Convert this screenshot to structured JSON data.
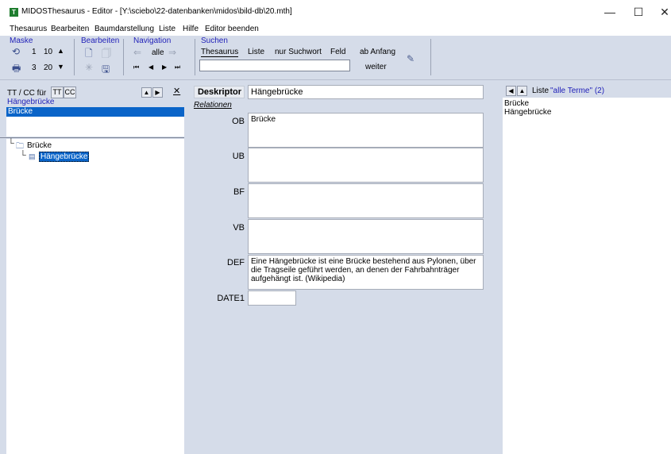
{
  "window": {
    "title": "MIDOSThesaurus - Editor - [Y:\\sciebo\\22-datenbanken\\midos\\bild-db\\20.mth]",
    "app_icon_letter": "T",
    "minimize": "—",
    "maximize": "☐",
    "close": "✕"
  },
  "menu": [
    "Thesaurus",
    "Bearbeiten",
    "Baumdarstellung",
    "Liste",
    "Hilfe",
    "Editor beenden"
  ],
  "toolbar": {
    "maske": {
      "label": "Maske",
      "row1_a": "1",
      "row1_b": "10",
      "row2_a": "3",
      "row2_b": "20"
    },
    "bearbeiten": {
      "label": "Bearbeiten"
    },
    "navigation": {
      "label": "Navigation",
      "alle": "alle"
    },
    "suchen": {
      "label": "Suchen",
      "tabs": [
        "Thesaurus",
        "Liste",
        "nur Suchwort",
        "Feld"
      ],
      "ab_anfang": "ab Anfang",
      "weiter": "weiter",
      "search_value": ""
    },
    "colors": {
      "group_label": "#1f1fb8",
      "panel_bg": "#d5dce9"
    }
  },
  "left": {
    "tt_cc_label": "TT / CC für",
    "tt_btn": "TT",
    "cc_btn": "CC",
    "current_term": "Hängebrücke",
    "list_items": [
      "Brücke"
    ],
    "tree_root": "Brücke",
    "tree_child": "Hängebrücke"
  },
  "center": {
    "deskriptor_label": "Deskriptor",
    "deskriptor_value": "Hängebrücke",
    "relationen_label": "Relationen",
    "fields": [
      {
        "label": "OB",
        "value": "Brücke"
      },
      {
        "label": "UB",
        "value": ""
      },
      {
        "label": "BF",
        "value": ""
      },
      {
        "label": "VB",
        "value": ""
      },
      {
        "label": "DEF",
        "value": "Eine Hängebrücke ist eine Brücke bestehend aus Pylonen, über die Tragseile geführt werden, an denen der Fahrbahnträger aufgehängt ist. (Wikipedia)"
      }
    ],
    "date_label": "DATE1",
    "date_value": ""
  },
  "right": {
    "list_label": "Liste",
    "list_name": "\"alle Terme\" (2)",
    "items": [
      "Brücke",
      "Hängebrücke"
    ]
  }
}
